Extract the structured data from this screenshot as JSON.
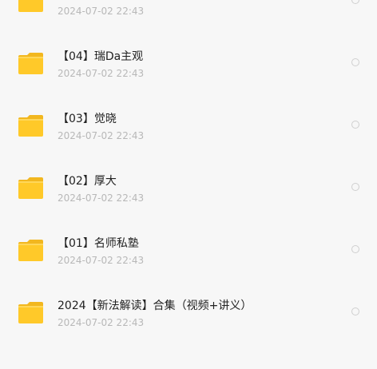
{
  "file_list": {
    "items": [
      {
        "name": "",
        "date": "2024-07-02 22:43",
        "icon": "folder-icon"
      },
      {
        "name": "【04】瑞Da主观",
        "date": "2024-07-02 22:43",
        "icon": "folder-icon"
      },
      {
        "name": "【03】觉晓",
        "date": "2024-07-02 22:43",
        "icon": "folder-icon"
      },
      {
        "name": "【02】厚大",
        "date": "2024-07-02 22:43",
        "icon": "folder-icon"
      },
      {
        "name": "【01】名师私塾",
        "date": "2024-07-02 22:43",
        "icon": "folder-icon"
      },
      {
        "name": "2024【新法解读】合集（视频+讲义）",
        "date": "2024-07-02 22:43",
        "icon": "folder-icon"
      }
    ]
  },
  "colors": {
    "folder": "#ffc929",
    "folder_tab": "#f2b71f",
    "background": "#f7f7f7"
  }
}
